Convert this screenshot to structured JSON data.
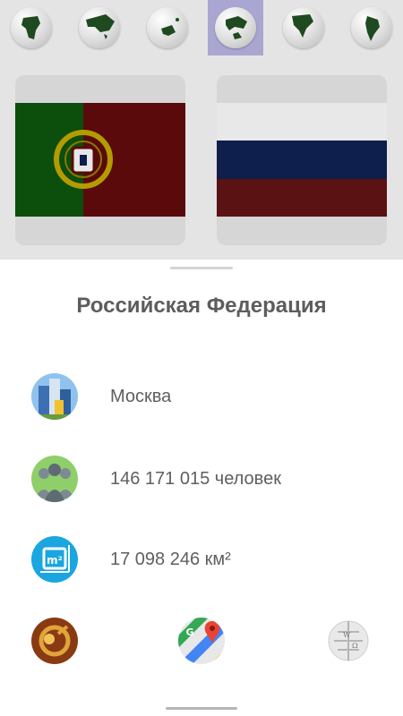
{
  "top_tabs": [
    {
      "icon": "africa-globe-icon"
    },
    {
      "icon": "asia-globe-icon"
    },
    {
      "icon": "oceania-globe-icon"
    },
    {
      "icon": "europe-globe-icon",
      "active": true
    },
    {
      "icon": "north-america-globe-icon"
    },
    {
      "icon": "south-america-globe-icon"
    }
  ],
  "cards": [
    {
      "flag": "portugal-flag-icon",
      "colors": {
        "green": "#0c4e0c",
        "red": "#5a0a0a"
      }
    },
    {
      "flag": "russia-flag-icon",
      "colors": {
        "white": "#e8e8e8",
        "blue": "#0e1f4d",
        "red": "#5a1212"
      }
    }
  ],
  "sheet": {
    "title": "Российская Федерация",
    "capital": {
      "icon": "city-buildings-icon",
      "value": "Москва"
    },
    "population": {
      "icon": "people-group-icon",
      "value": "146 171 015 человек"
    },
    "area": {
      "icon": "area-m2-icon",
      "value": "17 098 246 км²"
    },
    "actions": [
      {
        "icon": "anthem-horn-icon"
      },
      {
        "icon": "google-maps-icon"
      },
      {
        "icon": "wikipedia-globe-icon"
      }
    ]
  }
}
